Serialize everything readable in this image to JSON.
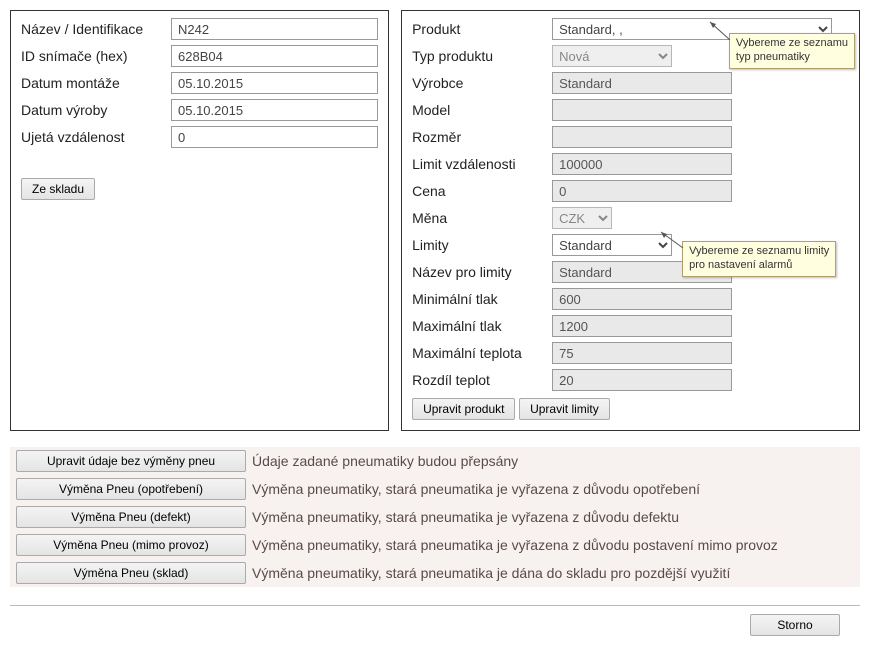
{
  "left": {
    "name_label": "Název / Identifikace",
    "name_value": "N242",
    "sensor_label": "ID snímače (hex)",
    "sensor_value": "628B04",
    "mount_label": "Datum montáže",
    "mount_value": "05.10.2015",
    "prod_date_label": "Datum výroby",
    "prod_date_value": "05.10.2015",
    "distance_label": "Ujetá vzdálenost",
    "distance_value": "0",
    "from_stock": "Ze skladu"
  },
  "right": {
    "product_label": "Produkt",
    "product_value": "Standard, , ",
    "product_type_label": "Typ produktu",
    "product_type_value": "Nová",
    "manufacturer_label": "Výrobce",
    "manufacturer_value": "Standard",
    "model_label": "Model",
    "model_value": "",
    "size_label": "Rozměr",
    "size_value": "",
    "dist_limit_label": "Limit vzdálenosti",
    "dist_limit_value": "100000",
    "price_label": "Cena",
    "price_value": "0",
    "currency_label": "Měna",
    "currency_value": "CZK",
    "limits_label": "Limity",
    "limits_value": "Standard",
    "limits_name_label": "Název pro limity",
    "limits_name_value": "Standard",
    "pmin_label": "Minimální tlak",
    "pmin_value": "600",
    "pmax_label": "Maximální tlak",
    "pmax_value": "1200",
    "tmax_label": "Maximální teplota",
    "tmax_value": "75",
    "tdiff_label": "Rozdíl teplot",
    "tdiff_value": "20",
    "edit_product_btn": "Upravit produkt",
    "edit_limits_btn": "Upravit limity",
    "callout1_l1": "Vybereme ze seznamu",
    "callout1_l2": "typ pneumatiky",
    "callout2_l1": "Vybereme ze seznamu limity",
    "callout2_l2": "pro nastavení alarmů"
  },
  "actions": [
    {
      "btn": "Upravit údaje bez výměny pneu",
      "desc": "Údaje zadané pneumatiky budou přepsány"
    },
    {
      "btn": "Výměna Pneu (opotřebení)",
      "desc": "Výměna pneumatiky, stará pneumatika je vyřazena z důvodu opotřebení"
    },
    {
      "btn": "Výměna Pneu (defekt)",
      "desc": "Výměna pneumatiky, stará pneumatika je vyřazena z důvodu defektu"
    },
    {
      "btn": "Výměna Pneu (mimo provoz)",
      "desc": "Výměna pneumatiky, stará pneumatika je vyřazena z důvodu postavení mimo provoz"
    },
    {
      "btn": "Výměna Pneu (sklad)",
      "desc": "Výměna pneumatiky, stará pneumatika je dána do skladu pro pozdější využití"
    }
  ],
  "footer": {
    "cancel": "Storno"
  }
}
